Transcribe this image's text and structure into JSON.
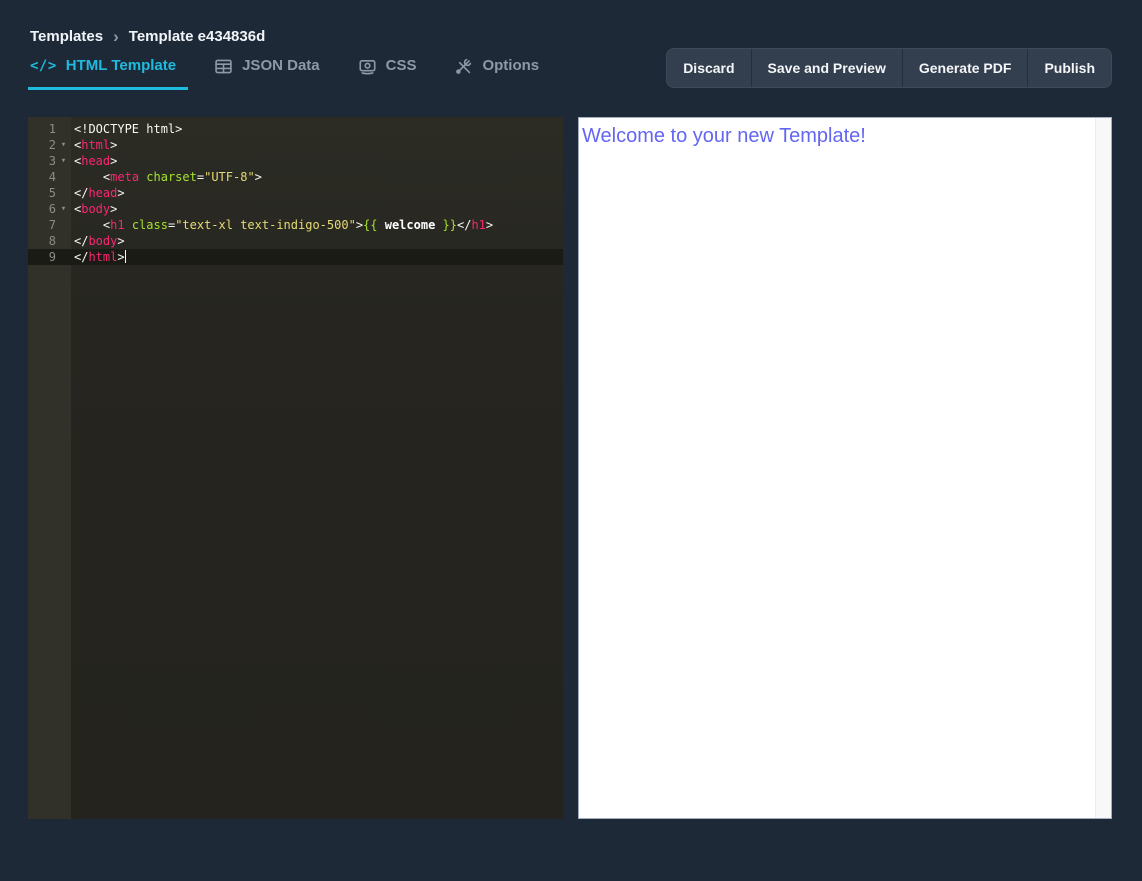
{
  "breadcrumb": {
    "root": "Templates",
    "separator": "›",
    "current": "Template e434836d"
  },
  "tabs": {
    "html": {
      "label": "HTML Template",
      "active": true
    },
    "json": {
      "label": "JSON Data",
      "active": false
    },
    "css": {
      "label": "CSS",
      "active": false
    },
    "options": {
      "label": "Options",
      "active": false
    }
  },
  "actions": {
    "discard": "Discard",
    "save_and_preview": "Save and Preview",
    "generate_pdf": "Generate PDF",
    "publish": "Publish"
  },
  "colors": {
    "page_bg": "#1e2938",
    "accent_cyan": "#1fbbde",
    "editor_bg": "#262520",
    "gutter_bg": "#31312a",
    "active_line_bg": "#1b1b16",
    "tag_pink": "#f92672",
    "attr_green": "#a6e22e",
    "string_yellow": "#e6db74",
    "plain_text": "#f8f8f2",
    "heading_indigo": "#6366f1",
    "button_bg": "#333e4e"
  },
  "editor": {
    "lines": [
      {
        "num": "1",
        "fold": false,
        "active": false,
        "cursor": false,
        "segments": [
          {
            "c": "p",
            "t": "<!DOCTYPE html>"
          }
        ]
      },
      {
        "num": "2",
        "fold": true,
        "active": false,
        "cursor": false,
        "segments": [
          {
            "c": "b",
            "t": "<"
          },
          {
            "c": "t",
            "t": "html"
          },
          {
            "c": "b",
            "t": ">"
          }
        ]
      },
      {
        "num": "3",
        "fold": true,
        "active": false,
        "cursor": false,
        "segments": [
          {
            "c": "b",
            "t": "<"
          },
          {
            "c": "t",
            "t": "head"
          },
          {
            "c": "b",
            "t": ">"
          }
        ]
      },
      {
        "num": "4",
        "fold": false,
        "active": false,
        "cursor": false,
        "segments": [
          {
            "c": "p",
            "t": "    "
          },
          {
            "c": "b",
            "t": "<"
          },
          {
            "c": "t",
            "t": "meta"
          },
          {
            "c": "p",
            "t": " "
          },
          {
            "c": "a",
            "t": "charset"
          },
          {
            "c": "p",
            "t": "="
          },
          {
            "c": "s",
            "t": "\"UTF-8\""
          },
          {
            "c": "b",
            "t": ">"
          }
        ]
      },
      {
        "num": "5",
        "fold": false,
        "active": false,
        "cursor": false,
        "segments": [
          {
            "c": "b",
            "t": "</"
          },
          {
            "c": "t",
            "t": "head"
          },
          {
            "c": "b",
            "t": ">"
          }
        ]
      },
      {
        "num": "6",
        "fold": true,
        "active": false,
        "cursor": false,
        "segments": [
          {
            "c": "b",
            "t": "<"
          },
          {
            "c": "t",
            "t": "body"
          },
          {
            "c": "b",
            "t": ">"
          }
        ]
      },
      {
        "num": "7",
        "fold": false,
        "active": false,
        "cursor": false,
        "segments": [
          {
            "c": "p",
            "t": "    "
          },
          {
            "c": "b",
            "t": "<"
          },
          {
            "c": "t",
            "t": "h1"
          },
          {
            "c": "p",
            "t": " "
          },
          {
            "c": "a",
            "t": "class"
          },
          {
            "c": "p",
            "t": "="
          },
          {
            "c": "s",
            "t": "\"text-xl text-indigo-500\""
          },
          {
            "c": "b",
            "t": ">"
          },
          {
            "c": "m",
            "t": "{{"
          },
          {
            "c": "w",
            "t": " welcome "
          },
          {
            "c": "m",
            "t": "}}"
          },
          {
            "c": "b",
            "t": "</"
          },
          {
            "c": "t",
            "t": "h1"
          },
          {
            "c": "b",
            "t": ">"
          }
        ]
      },
      {
        "num": "8",
        "fold": false,
        "active": false,
        "cursor": false,
        "segments": [
          {
            "c": "b",
            "t": "</"
          },
          {
            "c": "t",
            "t": "body"
          },
          {
            "c": "b",
            "t": ">"
          }
        ]
      },
      {
        "num": "9",
        "fold": false,
        "active": true,
        "cursor": true,
        "segments": [
          {
            "c": "b",
            "t": "</"
          },
          {
            "c": "t",
            "t": "html"
          },
          {
            "c": "b",
            "t": ">"
          }
        ]
      }
    ]
  },
  "preview": {
    "heading": "Welcome to your new Template!"
  }
}
